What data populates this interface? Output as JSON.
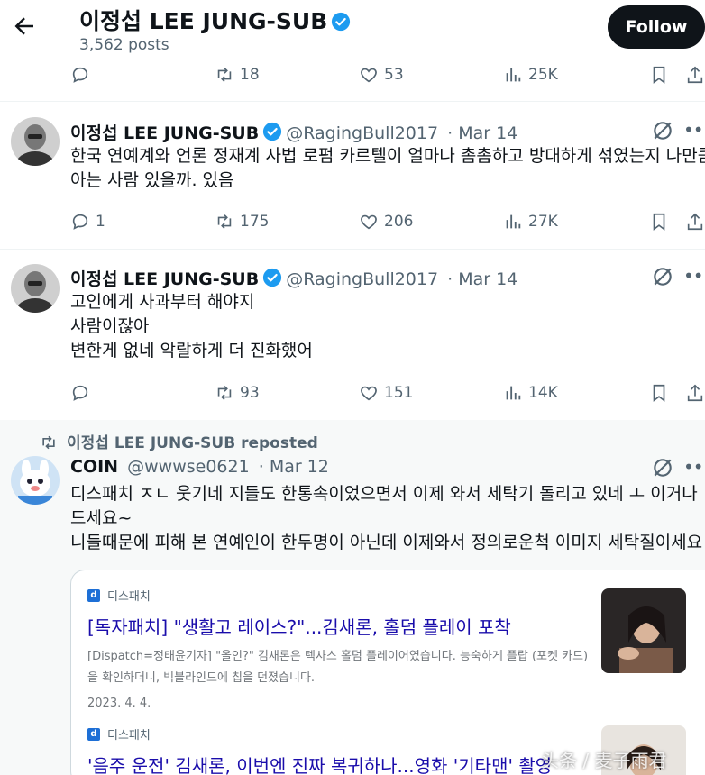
{
  "header": {
    "display_name": "이정섭 LEE JUNG-SUB",
    "post_count": "3,562 posts",
    "follow_label": "Follow"
  },
  "top_actions": {
    "replies": "",
    "reposts": "18",
    "likes": "53",
    "views": "25K"
  },
  "tweets": [
    {
      "name": "이정섭 LEE JUNG-SUB",
      "handle": "@RagingBull2017",
      "date": "· Mar 14",
      "lines": [
        "한국 연예계와 언론 정재계 사법 로펌 카르텔이 얼마나 촘촘하고 방대하게 섞였는지 나만큼",
        "아는 사람 있을까. 있음"
      ],
      "replies": "1",
      "reposts": "175",
      "likes": "206",
      "views": "27K"
    },
    {
      "name": "이정섭 LEE JUNG-SUB",
      "handle": "@RagingBull2017",
      "date": "· Mar 14",
      "lines": [
        "고인에게 사과부터 해야지",
        "사람이잖아",
        "변한게 없네 악랄하게 더 진화했어"
      ],
      "replies": "",
      "reposts": "93",
      "likes": "151",
      "views": "14K"
    }
  ],
  "repost": {
    "label": "이정섭 LEE JUNG-SUB reposted",
    "name": "COIN",
    "handle": "@wwwse0621",
    "date": "· Mar 12",
    "lines": [
      "디스패치 ㅈㄴ 웃기네 지들도 한통속이었으면서 이제 와서 세탁기 돌리고 있네 ㅗ 이거나",
      "드세요~",
      "니들때문에 피해 본 연예인이 한두명이 아닌데 이제와서 정의로운척 이미지 세탁질이세요"
    ],
    "news": [
      {
        "source": "디스패치",
        "title": "[독자패치] \"생활고 레이스?\"...김새론, 홀덤 플레이 포착",
        "snippet": "[Dispatch=정태윤기자] \"올인?\" 김새론은 텍사스 홀덤 플레이어였습니다. 능숙하게 플랍 (포켓 카드)을 확인하더니, 빅블라인드에 칩을 던졌습니다.",
        "date": "2023. 4. 4."
      },
      {
        "source": "디스패치",
        "title": "'음주 운전' 김새론, 이번엔 진짜 복귀하나...영화 '기타맨' 촬영"
      }
    ]
  },
  "watermark": "头条 / 麦子雨君",
  "colors": {
    "accent": "#1d9bf0",
    "text": "#0f1419",
    "muted": "#536471",
    "link": "#1a0dab"
  }
}
